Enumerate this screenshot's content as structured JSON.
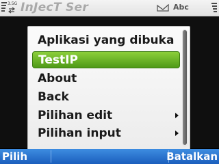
{
  "status_bar": {
    "network_label": "3.5G",
    "app_title": "InJecT Ser",
    "input_mode": "Abc",
    "icons": [
      "signal-strength-icon",
      "data-transfer-icon",
      "message-icon",
      "battery-icon"
    ]
  },
  "menu": {
    "items": [
      {
        "label": "Aplikasi yang dibuka",
        "selected": false,
        "has_submenu": false
      },
      {
        "label": "TestIP",
        "selected": true,
        "has_submenu": false
      },
      {
        "label": "About",
        "selected": false,
        "has_submenu": false
      },
      {
        "label": "Back",
        "selected": false,
        "has_submenu": false
      },
      {
        "label": "Pilihan edit",
        "selected": false,
        "has_submenu": true
      },
      {
        "label": "Pilihan input",
        "selected": false,
        "has_submenu": true
      }
    ]
  },
  "softkeys": {
    "left": "Pilih",
    "right": "Batalkan"
  },
  "colors": {
    "selection": "#5fae22",
    "softkey_bar": "#2a74d2",
    "background": "#0f0f0f"
  }
}
